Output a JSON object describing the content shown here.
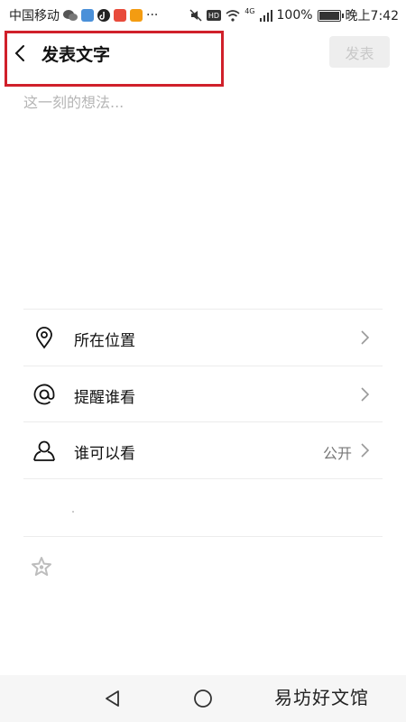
{
  "status_bar": {
    "carrier": "中国移动",
    "more": "···",
    "network": "4G",
    "battery_percent": "100%",
    "battery_level": 1.0,
    "time": "晚上7:42"
  },
  "header": {
    "title": "发表文字",
    "publish_label": "发表"
  },
  "composer": {
    "placeholder": "这一刻的想法..."
  },
  "options": {
    "location_label": "所在位置",
    "remind_label": "提醒谁看",
    "visibility_label": "谁可以看",
    "visibility_value": "公开"
  },
  "watermark": "易坊好文馆",
  "colors": {
    "highlight": "#d0202a",
    "publish_disabled_bg": "#eeeeee",
    "publish_disabled_text": "#c8c8c8"
  }
}
